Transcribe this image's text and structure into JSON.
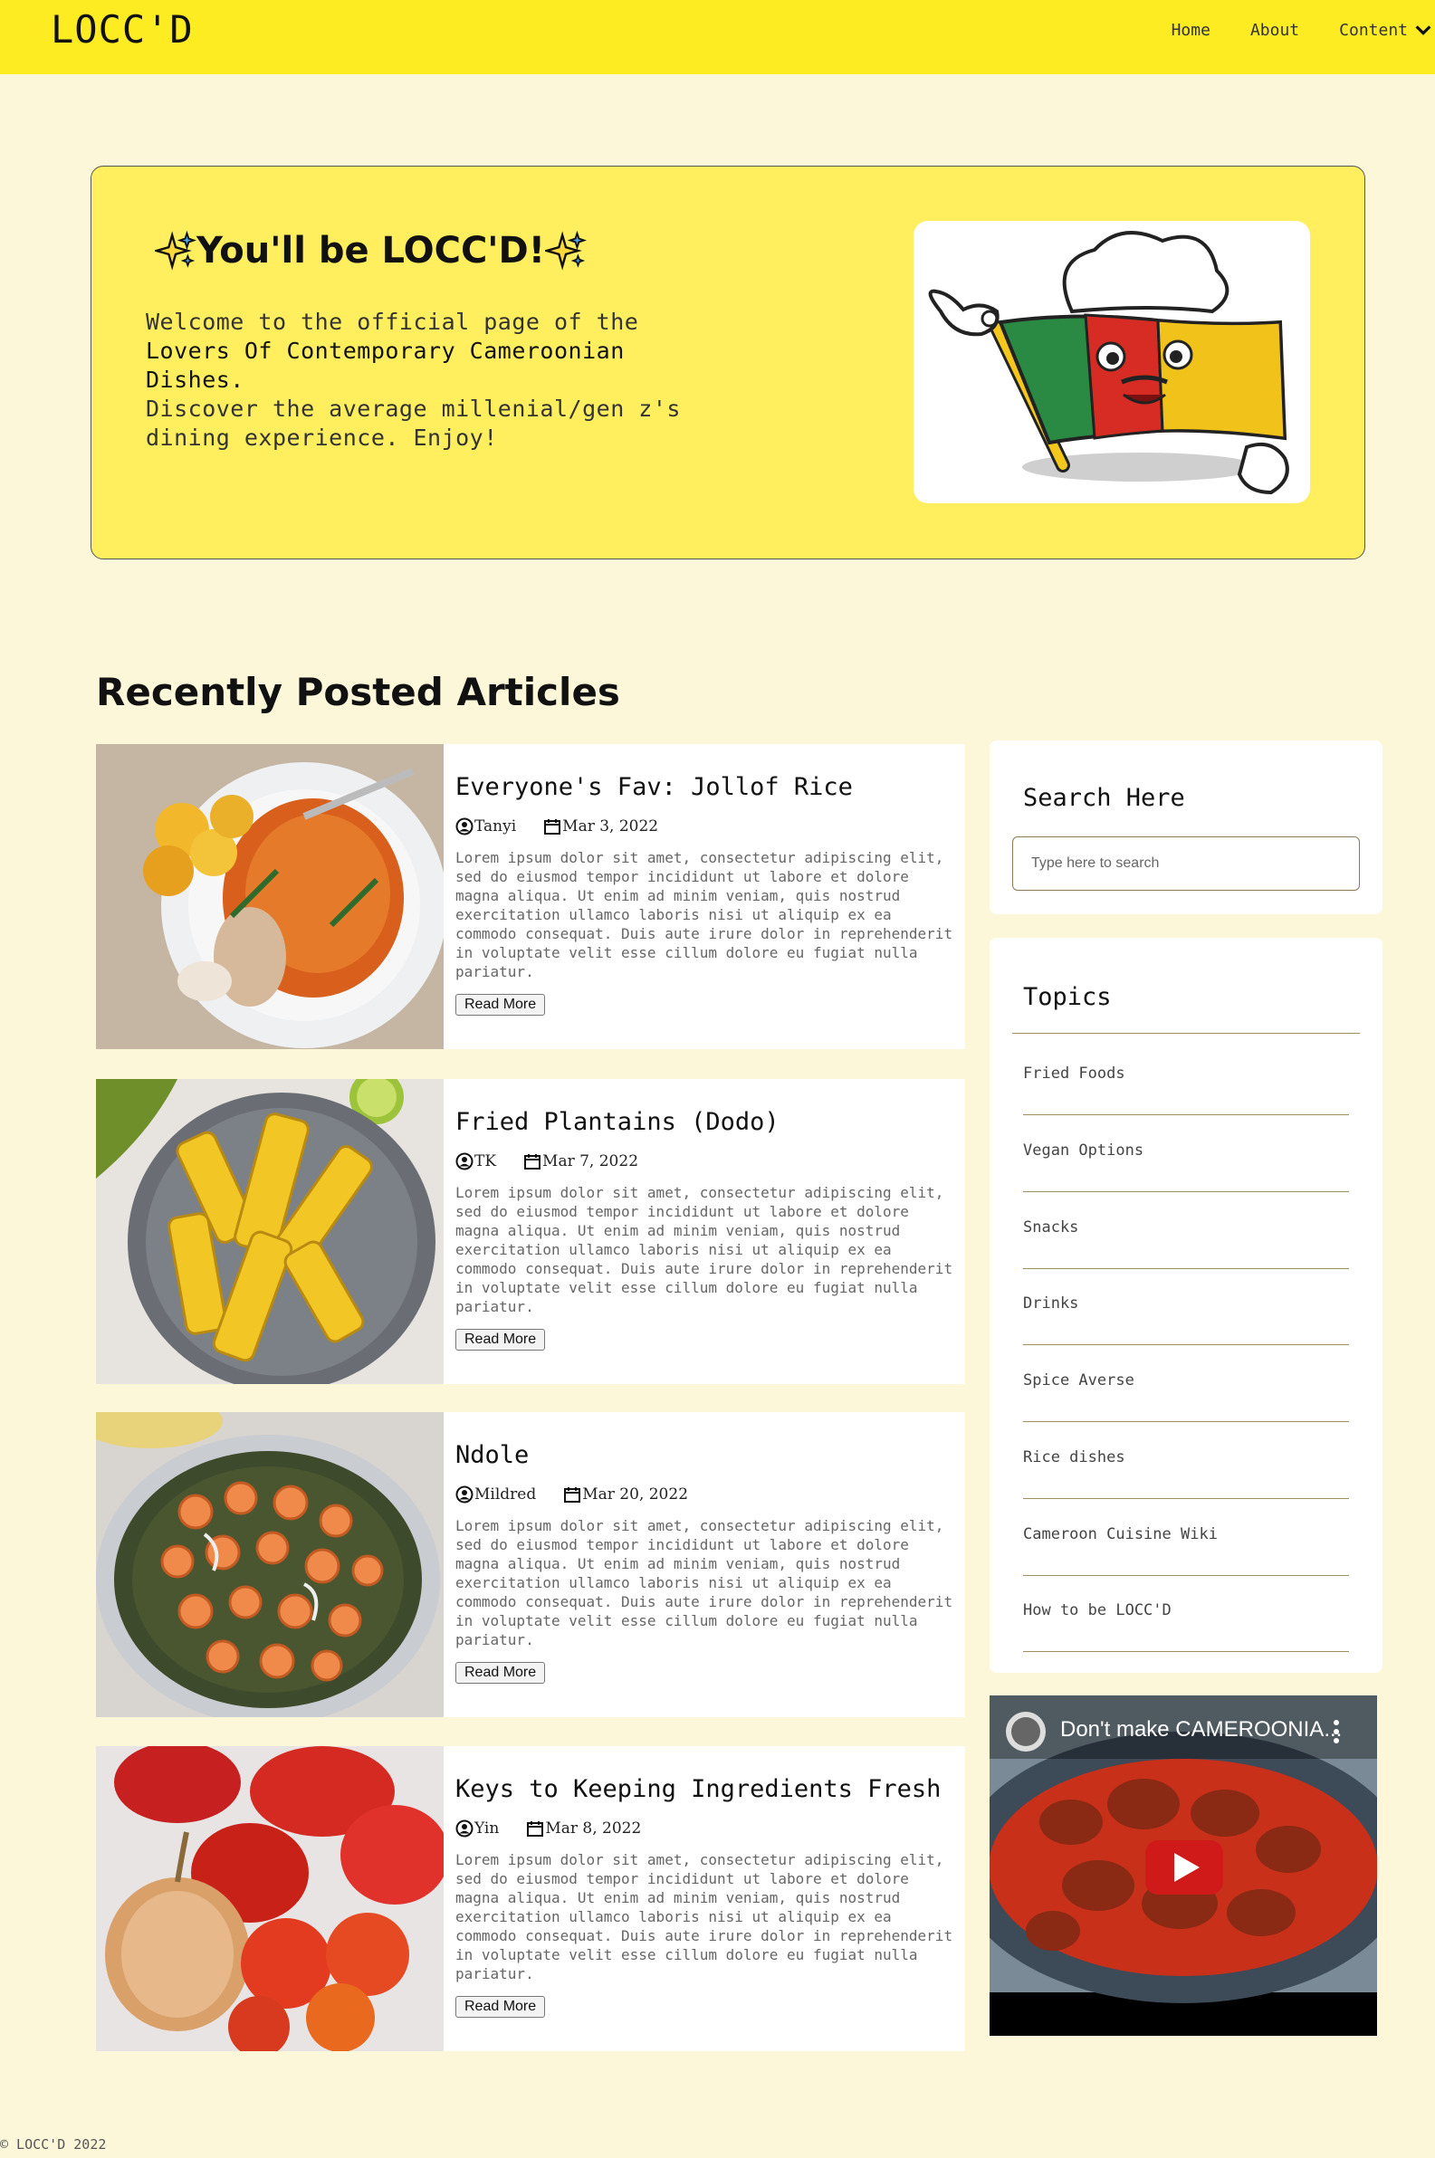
{
  "nav": {
    "brand": "LOCC'D",
    "links": [
      "Home",
      "About",
      "Content"
    ]
  },
  "hero": {
    "title": "You'll be LOCC'D!",
    "line1": "Welcome to the official page of the",
    "line2": "Lovers Of Contemporary Cameroonian",
    "line3": "Dishes.",
    "line4": "Discover the average millenial/gen z's",
    "line5": "dining experience. Enjoy!"
  },
  "section_title": "Recently Posted Articles",
  "articles": [
    {
      "title": "Everyone's Fav: Jollof Rice",
      "author": "Tanyi",
      "date": "Mar 3, 2022",
      "excerpt": "Lorem ipsum dolor sit amet, consectetur adipiscing elit, sed do eiusmod tempor incididunt ut labore et dolore magna aliqua. Ut enim ad minim veniam, quis nostrud exercitation ullamco laboris nisi ut aliquip ex ea commodo consequat. Duis aute irure dolor in reprehenderit in voluptate velit esse cillum dolore eu fugiat nulla pariatur.",
      "button": "Read More"
    },
    {
      "title": "Fried Plantains (Dodo)",
      "author": "TK",
      "date": "Mar 7, 2022",
      "excerpt": "Lorem ipsum dolor sit amet, consectetur adipiscing elit, sed do eiusmod tempor incididunt ut labore et dolore magna aliqua. Ut enim ad minim veniam, quis nostrud exercitation ullamco laboris nisi ut aliquip ex ea commodo consequat. Duis aute irure dolor in reprehenderit in voluptate velit esse cillum dolore eu fugiat nulla pariatur.",
      "button": "Read More"
    },
    {
      "title": "Ndole",
      "author": "Mildred",
      "date": "Mar 20, 2022",
      "excerpt": "Lorem ipsum dolor sit amet, consectetur adipiscing elit, sed do eiusmod tempor incididunt ut labore et dolore magna aliqua. Ut enim ad minim veniam, quis nostrud exercitation ullamco laboris nisi ut aliquip ex ea commodo consequat. Duis aute irure dolor in reprehenderit in voluptate velit esse cillum dolore eu fugiat nulla pariatur.",
      "button": "Read More"
    },
    {
      "title": "Keys to Keeping Ingredients Fresh",
      "author": "Yin",
      "date": "Mar 8, 2022",
      "excerpt": "Lorem ipsum dolor sit amet, consectetur adipiscing elit, sed do eiusmod tempor incididunt ut labore et dolore magna aliqua. Ut enim ad minim veniam, quis nostrud exercitation ullamco laboris nisi ut aliquip ex ea commodo consequat. Duis aute irure dolor in reprehenderit in voluptate velit esse cillum dolore eu fugiat nulla pariatur.",
      "button": "Read More"
    }
  ],
  "search": {
    "title": "Search Here",
    "placeholder": "Type here to search"
  },
  "topics": {
    "title": "Topics",
    "items": [
      "Fried Foods",
      "Vegan Options",
      "Snacks",
      "Drinks",
      "Spice Averse",
      "Rice dishes",
      "Cameroon Cuisine Wiki",
      "How to be LOCC'D"
    ]
  },
  "video": {
    "title": "Don't make CAMEROONIA..."
  },
  "footer": "© LOCC'D 2022",
  "colors": {
    "nav_bg": "#feec22",
    "page_bg": "#fdf7d9",
    "hero_bg": "#ffee5e"
  }
}
